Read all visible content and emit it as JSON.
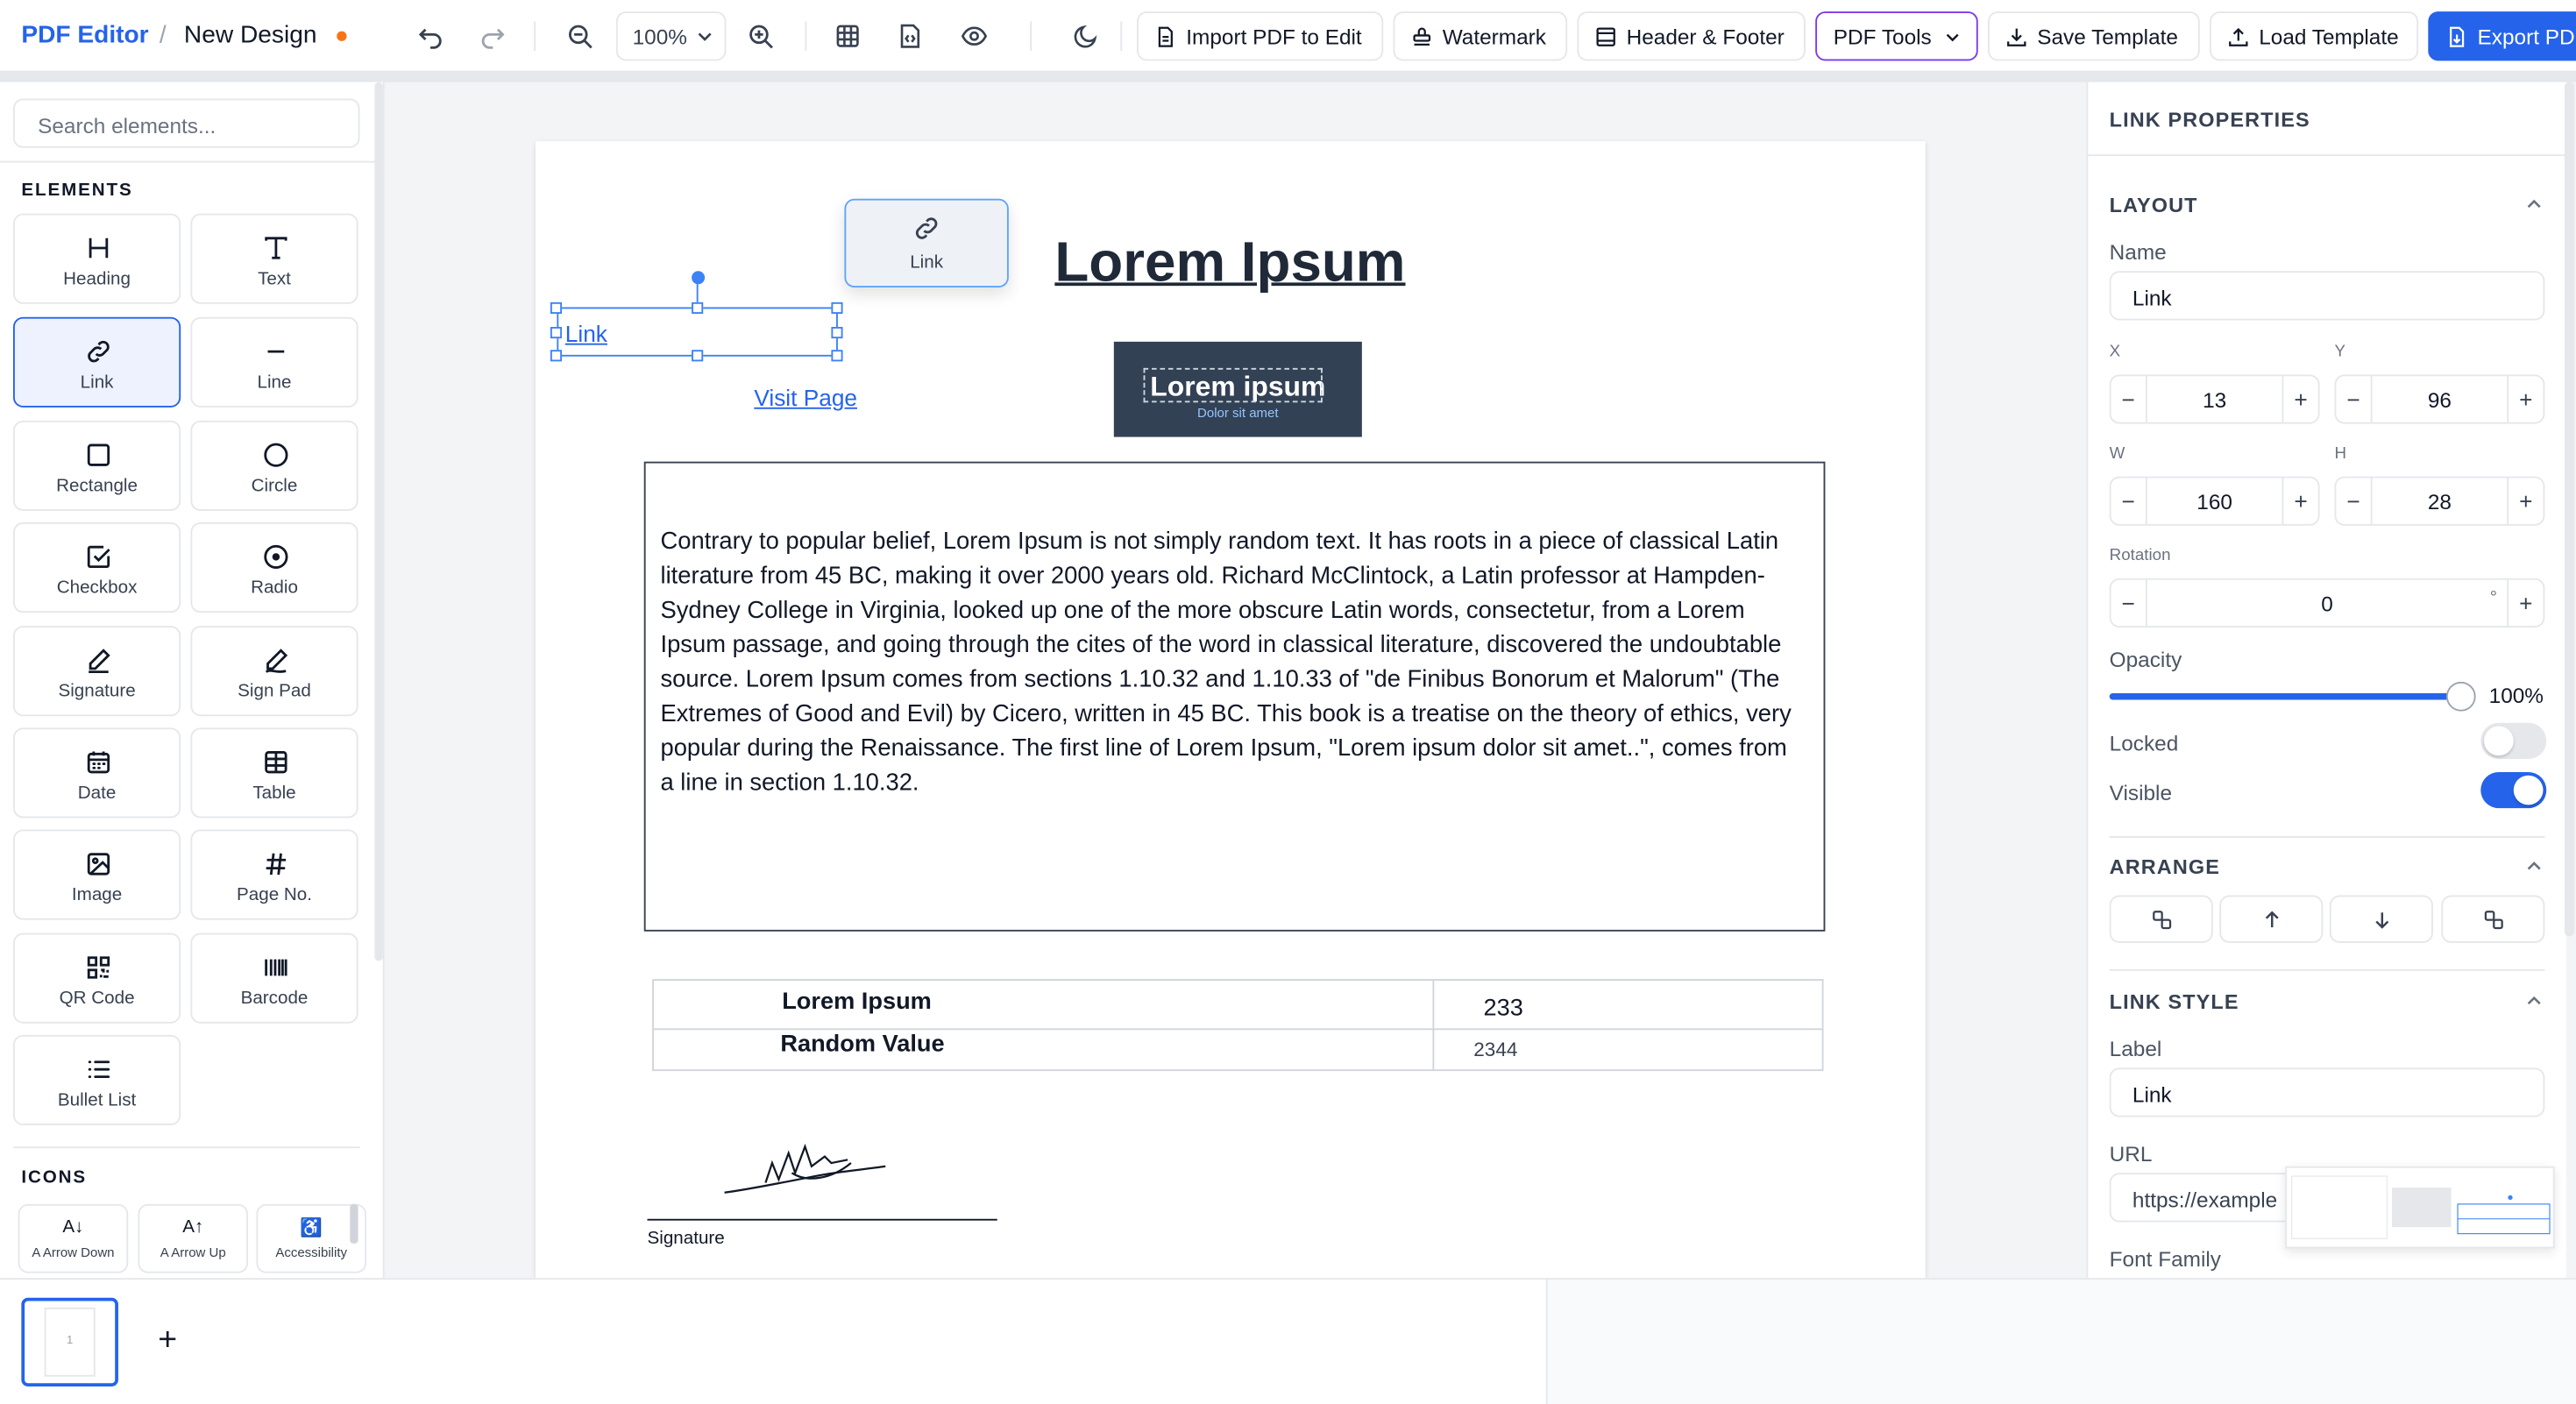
{
  "header": {
    "brand": "PDF Editor",
    "separator": "/",
    "doc_title": "New Design",
    "zoom": "100%",
    "buttons": {
      "import_pdf": "Import PDF to Edit",
      "watermark": "Watermark",
      "header_footer": "Header & Footer",
      "pdf_tools": "PDF Tools",
      "save_template": "Save Template",
      "load_template": "Load Template",
      "export": "Export PD"
    }
  },
  "sidebar": {
    "search_placeholder": "Search elements...",
    "elements_title": "ELEMENTS",
    "elements": [
      {
        "label": "Heading",
        "icon": "heading-icon"
      },
      {
        "label": "Text",
        "icon": "text-icon"
      },
      {
        "label": "Link",
        "icon": "link-icon"
      },
      {
        "label": "Line",
        "icon": "line-icon"
      },
      {
        "label": "Rectangle",
        "icon": "rectangle-icon"
      },
      {
        "label": "Circle",
        "icon": "circle-icon"
      },
      {
        "label": "Checkbox",
        "icon": "checkbox-icon"
      },
      {
        "label": "Radio",
        "icon": "radio-icon"
      },
      {
        "label": "Signature",
        "icon": "signature-icon"
      },
      {
        "label": "Sign Pad",
        "icon": "sign-pad-icon"
      },
      {
        "label": "Date",
        "icon": "calendar-icon"
      },
      {
        "label": "Table",
        "icon": "table-icon"
      },
      {
        "label": "Image",
        "icon": "image-icon"
      },
      {
        "label": "Page No.",
        "icon": "hash-icon"
      },
      {
        "label": "QR Code",
        "icon": "qr-code-icon"
      },
      {
        "label": "Barcode",
        "icon": "barcode-icon"
      },
      {
        "label": "Bullet List",
        "icon": "list-icon"
      }
    ],
    "icons_title": "ICONS",
    "icons": [
      {
        "glyph": "A↓",
        "label": "A Arrow Down"
      },
      {
        "glyph": "A↑",
        "label": "A Arrow Up"
      },
      {
        "glyph": "♿",
        "label": "Accessibility"
      }
    ]
  },
  "canvas": {
    "drag_ghost_label": "Link",
    "link_text": "Link",
    "heading": "Lorem Ipsum",
    "visit_link": "Visit Page",
    "logo_title": "Lorem ipsum",
    "logo_subtitle": "Dolor sit amet",
    "paragraph": "Contrary to popular belief, Lorem Ipsum is not simply random text. It has roots in a piece of classical Latin literature from 45 BC, making it over 2000 years old. Richard McClintock, a Latin professor at Hampden-Sydney College in Virginia, looked up one of the more obscure Latin words, consectetur, from a Lorem Ipsum passage, and going through the cites of the word in classical literature, discovered the undoubtable source. Lorem Ipsum comes from sections 1.10.32 and 1.10.33 of \"de Finibus Bonorum et Malorum\" (The Extremes of Good and Evil) by Cicero, written in 45 BC. This book is a treatise on the theory of ethics, very popular during the Renaissance. The first line of Lorem Ipsum, \"Lorem ipsum dolor sit amet..\", comes from a line in section 1.10.32.",
    "table": [
      {
        "label": "Lorem Ipsum",
        "value": "233"
      },
      {
        "label": "Random Value",
        "value": "2344"
      }
    ],
    "signature_label": "Signature"
  },
  "properties": {
    "title": "LINK PROPERTIES",
    "layout_title": "LAYOUT",
    "name_label": "Name",
    "name_value": "Link",
    "x_label": "X",
    "x_value": "13",
    "y_label": "Y",
    "y_value": "96",
    "w_label": "W",
    "w_value": "160",
    "h_label": "H",
    "h_value": "28",
    "rotation_label": "Rotation",
    "rotation_value": "0",
    "rotation_unit": "°",
    "opacity_label": "Opacity",
    "opacity_value": "100%",
    "opacity_fraction": 1.0,
    "locked_label": "Locked",
    "locked": false,
    "visible_label": "Visible",
    "visible": true,
    "arrange_title": "ARRANGE",
    "link_style_title": "LINK STYLE",
    "label_label": "Label",
    "label_value": "Link",
    "url_label": "URL",
    "url_value": "https://example",
    "font_family_label": "Font Family"
  },
  "pages": {
    "current_page": "1",
    "add_page": "+"
  },
  "colors": {
    "accent": "#2563eb",
    "pdf_tools_border": "#7c3aed",
    "unsaved": "#f97316",
    "logo_bg": "#334155"
  }
}
